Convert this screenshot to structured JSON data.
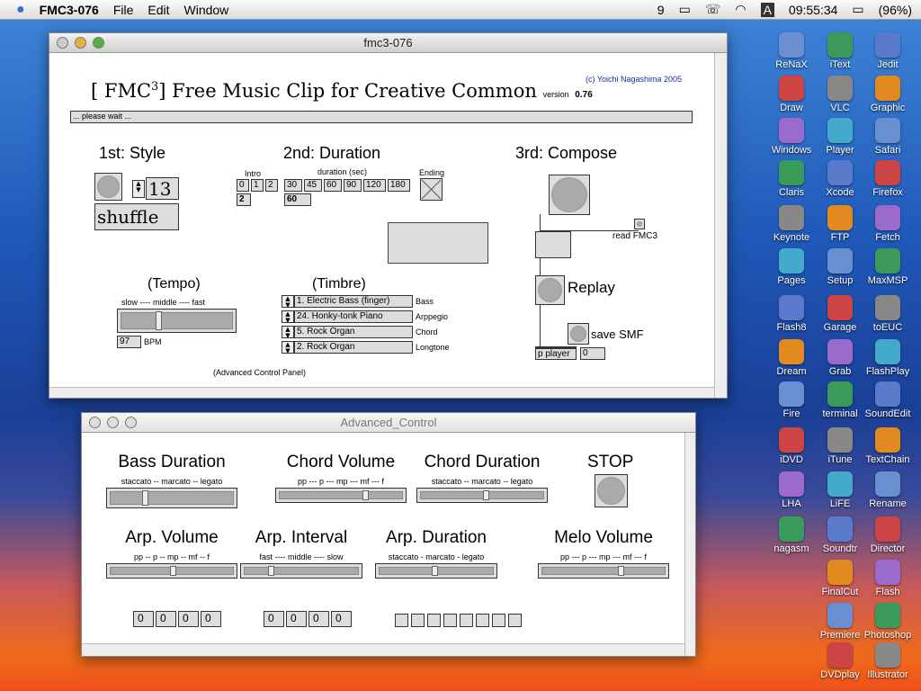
{
  "menubar": {
    "app": "FMC3-076",
    "items": [
      "File",
      "Edit",
      "Window"
    ],
    "clock": "09:55:34",
    "battery": "(96%)",
    "status_icons": [
      "nine-icon",
      "display-icon",
      "phone-icon",
      "wifi-icon",
      "input-a-icon"
    ]
  },
  "main_window": {
    "title": "fmc3-076",
    "header_title_pre": "[ FMC",
    "header_sup": "3",
    "header_title_post": "] Free Music Clip for Creative Common",
    "copyright": "(c) Yoichi Nagashima 2005",
    "version_label": "version",
    "version": "0.76",
    "status": "... please wait ...",
    "style": {
      "heading": "1st: Style",
      "number": "13",
      "value": "shuffle"
    },
    "duration": {
      "heading": "2nd: Duration",
      "intro_label": "Intro",
      "intro_options": [
        "0",
        "1",
        "2"
      ],
      "intro_value": "2",
      "duration_label": "duration (sec)",
      "duration_options": [
        "30",
        "45",
        "60",
        "90",
        "120",
        "180"
      ],
      "duration_value": "60",
      "ending_label": "Ending"
    },
    "compose": {
      "heading": "3rd: Compose",
      "read_label": "read FMC3",
      "replay_label": "Replay",
      "save_label": "save SMF",
      "player_label": "p player",
      "player_value": "0"
    },
    "tempo": {
      "heading": "(Tempo)",
      "scale": "slow ---- middle ---- fast",
      "bpm": "97",
      "bpm_unit": "BPM",
      "level": 0.33
    },
    "timbre": {
      "heading": "(Timbre)",
      "rows": [
        {
          "instrument": "1. Electric Bass (finger)",
          "part": "Bass"
        },
        {
          "instrument": "24. Honky-tonk Piano",
          "part": "Arppegio"
        },
        {
          "instrument": "5. Rock Organ",
          "part": "Chord"
        },
        {
          "instrument": "2. Rock Organ",
          "part": "Longtone"
        }
      ]
    },
    "advanced_link": "(Advanced Control Panel)"
  },
  "advanced_window": {
    "title": "Advanced_Control",
    "stop_label": "STOP",
    "sliders": [
      {
        "title": "Bass Duration",
        "scale": "staccato -- marcato -- legato",
        "level": 0.27
      },
      {
        "title": "Chord Volume",
        "scale": "pp --- p --- mp --- mf --- f",
        "level": 0.7
      },
      {
        "title": "Chord Duration",
        "scale": "staccato -- marcato -- legato",
        "level": 0.53
      },
      {
        "title": "Arp. Volume",
        "scale": "pp -- p -- mp -- mf -- f",
        "level": 0.5
      },
      {
        "title": "Arp. Interval",
        "scale": "fast ---- middle ---- slow",
        "level": 0.22
      },
      {
        "title": "Arp. Duration",
        "scale": "staccato - marcato - legato",
        "level": 0.48
      },
      {
        "title": "Melo Volume",
        "scale": "pp --- p --- mp --- mf --- f",
        "level": 0.64
      }
    ],
    "numbers_a": [
      "0",
      "0",
      "0",
      "0"
    ],
    "numbers_b": [
      "0",
      "0",
      "0",
      "0"
    ],
    "toggles": 8
  },
  "desktop": {
    "columns": [
      [
        "ReNaX",
        "Draw",
        "Windows",
        "Claris",
        "Keynote",
        "Pages",
        "Flash8",
        "Dream",
        "Fire",
        "iDVD",
        "LHA",
        "nagasm"
      ],
      [
        "iText",
        "VLC",
        "Player",
        "Xcode",
        "FTP",
        "Setup",
        "Garage",
        "Grab",
        "terminal",
        "iTune",
        "LiFE",
        "Soundtr",
        "FinalCut",
        "Premiere",
        "DVDplay"
      ],
      [
        "Jedit",
        "Graphic",
        "Safari",
        "Firefox",
        "Fetch",
        "MaxMSP",
        "toEUC",
        "FlashPlay",
        "SoundEdit",
        "TextChain",
        "Rename",
        "Director",
        "Flash",
        "Photoshop",
        "Illustrator"
      ]
    ],
    "colors": [
      "#6a8fd0",
      "#3a9a5a",
      "#5a7acc",
      "#cc4444",
      "#888888",
      "#e08a20",
      "#9a6acc",
      "#44aacc"
    ]
  }
}
